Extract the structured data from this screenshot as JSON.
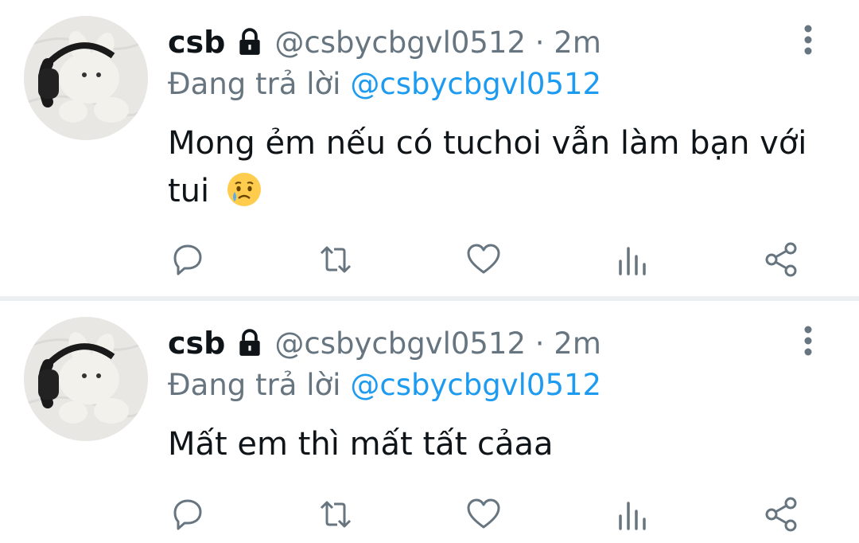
{
  "tweets": [
    {
      "display_name": "csb",
      "handle_time": "@csbycbgvl0512 · 2m",
      "reply_prefix": "Đang trả lời",
      "reply_target": "@csbycbgvl0512",
      "text": "Mong ẻm nếu có tuchoi vẫn làm bạn với tui",
      "emoji": "crying-face-emoji",
      "icons": [
        "lock-icon",
        "more-vertical-icon",
        "reply-icon",
        "retweet-icon",
        "like-icon",
        "views-icon",
        "share-icon"
      ]
    },
    {
      "display_name": "csb",
      "handle_time": "@csbycbgvl0512 · 2m",
      "reply_prefix": "Đang trả lời",
      "reply_target": "@csbycbgvl0512",
      "text": "Mất em thì mất tất cảaa",
      "icons": [
        "lock-icon",
        "more-vertical-icon",
        "reply-icon",
        "retweet-icon",
        "like-icon",
        "views-icon",
        "share-icon"
      ]
    }
  ],
  "colors": {
    "text": "#0f1419",
    "muted": "#66757f",
    "link": "#1d9bf0",
    "divider": "#eceff1"
  }
}
